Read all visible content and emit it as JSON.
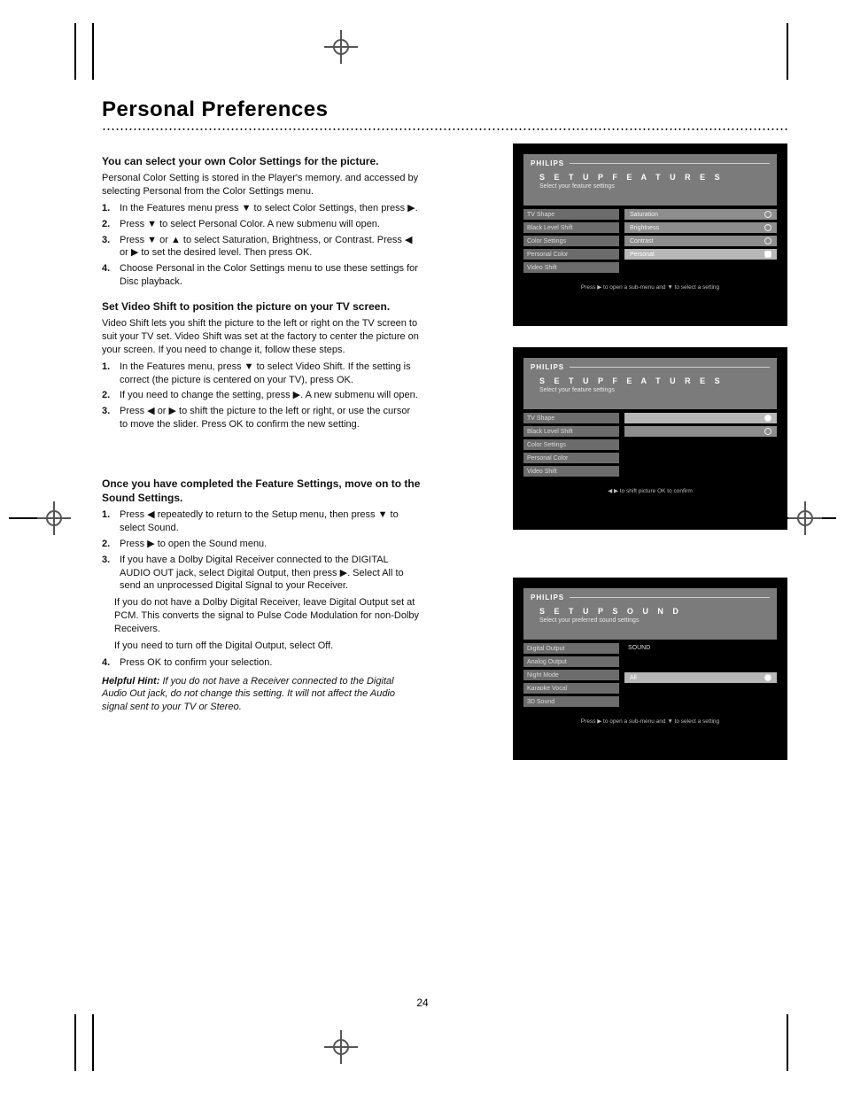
{
  "page": {
    "number": "24",
    "title": "Personal Preferences"
  },
  "section_a": {
    "heading": "You can select your own Color Settings for the picture.",
    "body": "Personal Color Setting is stored in the Player's memory. and accessed by selecting Personal from the Color Settings menu.",
    "steps": [
      "In the Features menu press ▼ to select Color Settings, then press ▶.",
      "Press ▼ to select Personal Color.    A new submenu will open.",
      "Press ▼ or ▲ to select Saturation, Brightness, or Contrast. Press ◀ or ▶ to set the desired level. Then press OK.",
      "Choose Personal in the Color Settings menu to use these settings for Disc playback."
    ]
  },
  "section_b": {
    "heading": "Set Video Shift to position the picture on your TV screen.",
    "body": "Video Shift lets you shift the picture to the left or right on the TV screen to suit your TV set. Video Shift was set at the factory to center the picture on your screen. If you need to change it, follow these steps.",
    "steps": [
      "In the Features menu, press ▼ to select Video Shift.    If the setting is correct (the picture is centered on your TV), press OK.",
      "If you need to change the setting, press ▶.    A new submenu will open.",
      "Press ◀ or ▶ to shift the picture to the left or right, or use the cursor to move the slider. Press OK to confirm the new setting."
    ]
  },
  "section_c": {
    "heading": "Once you have completed the Feature Settings, move on to the Sound Settings.",
    "steps": [
      "Press ◀ repeatedly to return to the Setup menu, then press ▼ to select Sound.",
      "Press ▶ to open the Sound menu.",
      "If you have a Dolby Digital Receiver connected to the DIGITAL AUDIO OUT jack, select Digital Output, then press ▶. Select All to send an unprocessed Digital Signal to your Receiver.",
      "If you do not have a Dolby Digital Receiver, leave Digital Output set at PCM. This converts the signal to Pulse Code Modulation for non-Dolby Receivers.",
      "If you need to turn off the Digital Output, select Off.",
      "Press OK to confirm your selection."
    ],
    "tip_label": "Helpful Hint:",
    "tip": "If you do not have a Receiver connected to the Digital Audio Out jack, do not change this setting. It will not affect the Audio signal sent to your TV or Stereo."
  },
  "osd1": {
    "brand": "PHILIPS",
    "title": "S E T U P   F E A T U R E S",
    "subtitle": "Select your feature settings",
    "menu": [
      "TV Shape",
      "Black Level Shift",
      "Color Settings",
      "Personal Color",
      "Video Shift"
    ],
    "options": [
      {
        "label": "Saturation",
        "selected": false
      },
      {
        "label": "Brightness",
        "selected": false
      },
      {
        "label": "Contrast",
        "selected": false
      },
      {
        "label": "Personal",
        "selected": true
      }
    ],
    "hint": "Press ▶ to open a sub-menu and ▼ to select a setting"
  },
  "osd2": {
    "brand": "PHILIPS",
    "title": "S E T U P   F E A T U R E S",
    "subtitle": "Select your feature settings",
    "menu": [
      "TV Shape",
      "Black Level Shift",
      "Color Settings",
      "Personal Color",
      "Video Shift"
    ],
    "options": [
      {
        "label": "",
        "selected": true
      },
      {
        "label": "",
        "selected": false
      }
    ],
    "hint": "◀ ▶ to shift picture    OK to confirm"
  },
  "osd3": {
    "brand": "PHILIPS",
    "title": "S E T U P   S O U N D",
    "subtitle": "Select your preferred sound settings",
    "menu": [
      "Digital Output",
      "Analog Output",
      "Night Mode",
      "Karaoke Vocal",
      "3D Sound"
    ],
    "sound_label": "SOUND",
    "options": [
      {
        "label": "All",
        "selected": true
      }
    ],
    "hint": "Press ▶ to open a sub-menu and ▼ to select a setting"
  }
}
